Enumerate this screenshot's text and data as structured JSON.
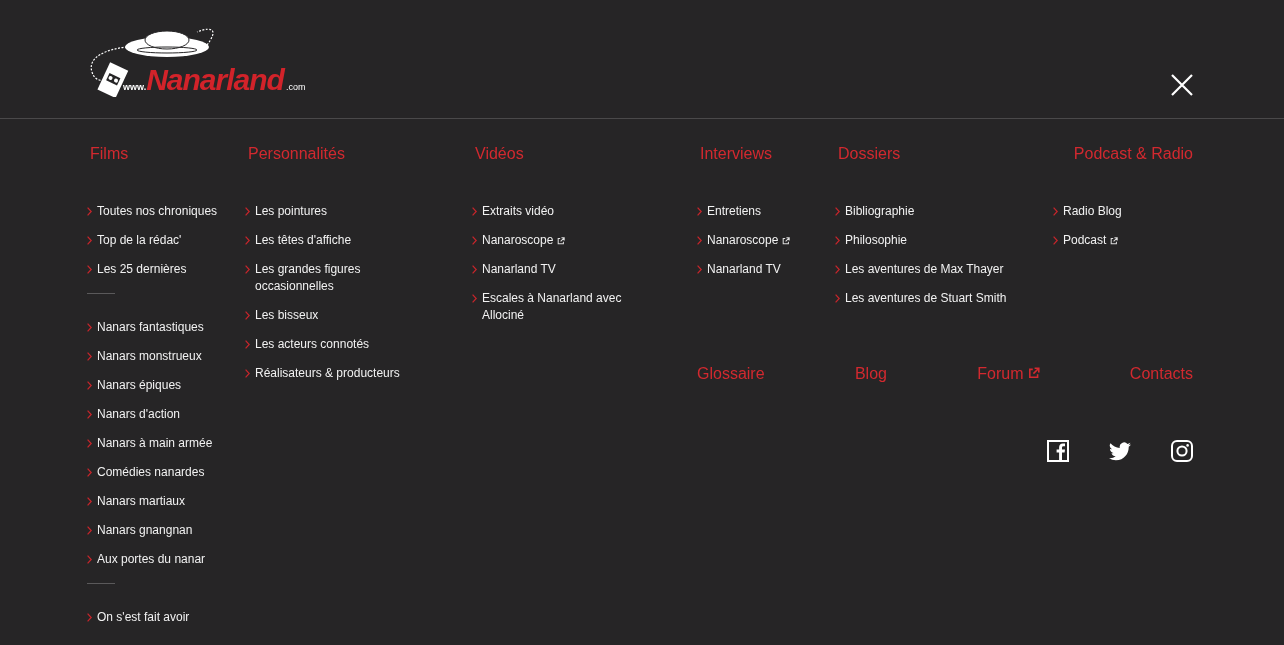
{
  "logo": {
    "prefix": "www.",
    "name": "Nanarland",
    "suffix": ".com"
  },
  "menu_columns": [
    {
      "title": "Films",
      "groups": [
        {
          "items": [
            {
              "label": "Toutes nos chroniques",
              "external": false
            },
            {
              "label": "Top de la rédac'",
              "external": false
            },
            {
              "label": "Les 25 dernières",
              "external": false
            }
          ]
        },
        {
          "items": [
            {
              "label": "Nanars fantastiques",
              "external": false
            },
            {
              "label": "Nanars monstrueux",
              "external": false
            },
            {
              "label": "Nanars épiques",
              "external": false
            },
            {
              "label": "Nanars d'action",
              "external": false
            },
            {
              "label": "Nanars à main armée",
              "external": false
            },
            {
              "label": "Comédies nanardes",
              "external": false
            },
            {
              "label": "Nanars martiaux",
              "external": false
            },
            {
              "label": "Nanars gnangnan",
              "external": false
            },
            {
              "label": "Aux portes du nanar",
              "external": false
            }
          ]
        },
        {
          "items": [
            {
              "label": "On s'est fait avoir",
              "external": false
            }
          ]
        }
      ]
    },
    {
      "title": "Personnalités",
      "groups": [
        {
          "items": [
            {
              "label": "Les pointures",
              "external": false
            },
            {
              "label": "Les têtes d'affiche",
              "external": false
            },
            {
              "label": "Les grandes figures occasionnelles",
              "external": false
            },
            {
              "label": "Les bisseux",
              "external": false
            },
            {
              "label": "Les acteurs connotés",
              "external": false
            },
            {
              "label": "Réalisateurs & producteurs",
              "external": false
            }
          ]
        }
      ]
    },
    {
      "title": "Vidéos",
      "groups": [
        {
          "items": [
            {
              "label": "Extraits vidéo",
              "external": false
            },
            {
              "label": "Nanaroscope",
              "external": true
            },
            {
              "label": "Nanarland TV",
              "external": false
            },
            {
              "label": "Escales à Nanarland avec Allociné",
              "external": false
            }
          ]
        }
      ]
    },
    {
      "title": "Interviews",
      "groups": [
        {
          "items": [
            {
              "label": "Entretiens",
              "external": false
            },
            {
              "label": "Nanaroscope",
              "external": true
            },
            {
              "label": "Nanarland TV",
              "external": false
            }
          ]
        }
      ]
    },
    {
      "title": "Dossiers",
      "groups": [
        {
          "items": [
            {
              "label": "Bibliographie",
              "external": false
            },
            {
              "label": "Philosophie",
              "external": false
            },
            {
              "label": "Les aventures de Max Thayer",
              "external": false
            },
            {
              "label": "Les aventures de Stuart Smith",
              "external": false
            }
          ]
        }
      ]
    },
    {
      "title": "Podcast & Radio",
      "groups": [
        {
          "items": [
            {
              "label": "Radio Blog",
              "external": false
            },
            {
              "label": "Podcast",
              "external": true
            }
          ]
        }
      ]
    }
  ],
  "top_links": [
    {
      "label": "Glossaire",
      "external": false
    },
    {
      "label": "Blog",
      "external": false
    },
    {
      "label": "Forum",
      "external": true
    },
    {
      "label": "Contacts",
      "external": false
    }
  ],
  "social": [
    {
      "kind": "facebook"
    },
    {
      "kind": "twitter"
    },
    {
      "kind": "instagram"
    }
  ]
}
